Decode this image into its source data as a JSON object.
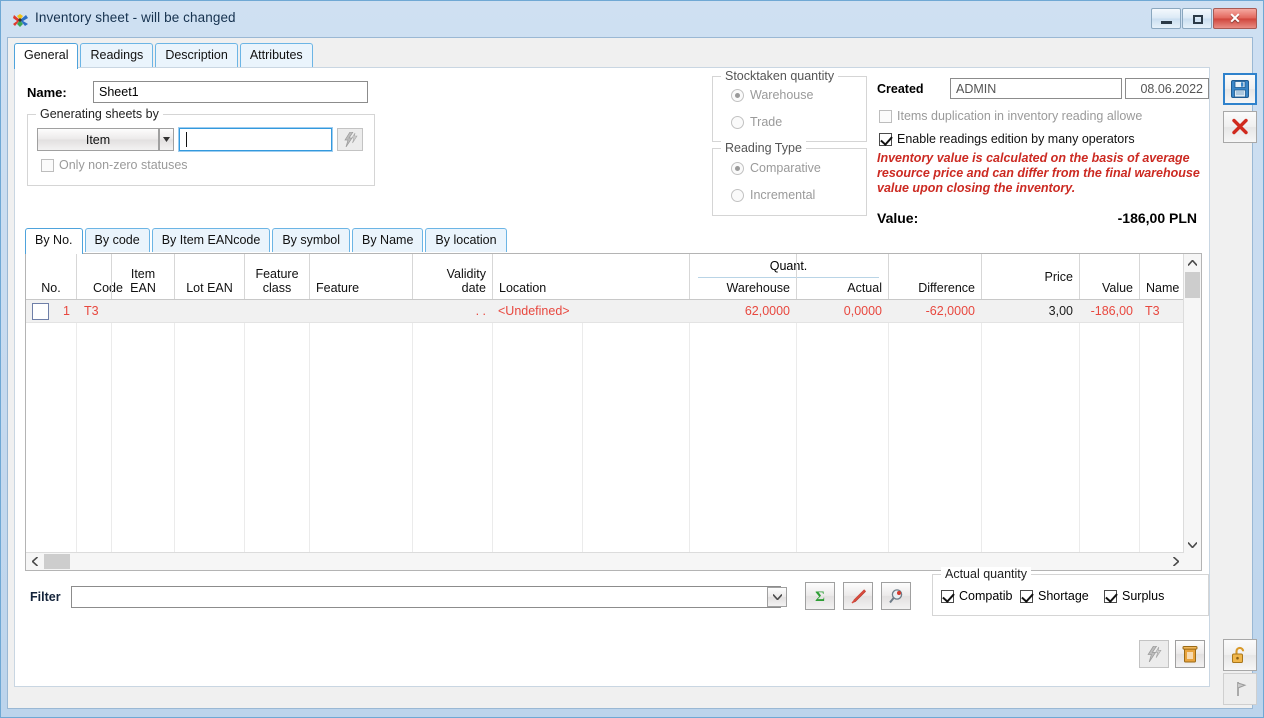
{
  "window": {
    "title": "Inventory sheet - will be changed",
    "icon": "butterfly-icon",
    "minimize_label": "Minimize",
    "maximize_label": "Maximize",
    "close_label": "✕"
  },
  "main_tabs": [
    {
      "label": "General",
      "active": true
    },
    {
      "label": "Readings",
      "active": false
    },
    {
      "label": "Description",
      "active": false
    },
    {
      "label": "Attributes",
      "active": false
    }
  ],
  "form": {
    "name_label": "Name:",
    "name_value": "Sheet1",
    "generating_group": "Generating sheets by",
    "generating_kind": "Item",
    "generating_value": "",
    "generating_placeholder": "",
    "generate_button_icon": "lightning-icon",
    "only_nonzero_label": "Only non-zero statuses",
    "only_nonzero_checked": false
  },
  "stocktaken": {
    "caption": "Stocktaken quantity",
    "options": [
      {
        "label": "Warehouse",
        "selected": true
      },
      {
        "label": "Trade",
        "selected": false
      }
    ]
  },
  "reading_type": {
    "caption": "Reading Type",
    "options": [
      {
        "label": "Comparative",
        "selected": true
      },
      {
        "label": "Incremental",
        "selected": false
      }
    ]
  },
  "created": {
    "label": "Created",
    "user": "ADMIN",
    "date": "08.06.2022",
    "duplication_label": "Items duplication in inventory reading allowe",
    "duplication_checked": false,
    "many_operators_label": "Enable readings edition by many operators",
    "many_operators_checked": true,
    "warning": "Inventory value is calculated on the basis of average resource price and can differ from the final warehouse value upon closing the inventory.",
    "value_label": "Value:",
    "value_amount": "-186,00 PLN"
  },
  "sub_tabs": [
    {
      "label": "By No.",
      "active": true
    },
    {
      "label": "By code",
      "active": false
    },
    {
      "label": "By Item EANcode",
      "active": false
    },
    {
      "label": "By symbol",
      "active": false
    },
    {
      "label": "By Name",
      "active": false
    },
    {
      "label": "By location",
      "active": false
    }
  ],
  "grid": {
    "group_header": "Quant.",
    "columns": [
      "No.",
      "Code",
      "Item EAN",
      "Lot EAN",
      "Feature class",
      "Feature",
      "Validity date",
      "Location",
      "Warehouse",
      "Actual",
      "Difference",
      "Price",
      "Value",
      "Name"
    ],
    "rows": [
      {
        "no": "1",
        "code": "T3",
        "item_ean": "",
        "lot_ean": "",
        "feature_class": "",
        "feature": "",
        "validity_date": ". .",
        "location": "<Undefined>",
        "warehouse": "62,0000",
        "actual": "0,0000",
        "difference": "-62,0000",
        "price": "3,00",
        "value": "-186,00",
        "name": "T3",
        "selected": false
      }
    ]
  },
  "filter": {
    "label": "Filter",
    "value": "",
    "placeholder": "",
    "dropdown_icon": "chevron-down-icon",
    "buttons": [
      {
        "name": "sum-button",
        "icon": "sigma-icon"
      },
      {
        "name": "edit-button",
        "icon": "pen-icon"
      },
      {
        "name": "find-button",
        "icon": "magnifier-icon"
      }
    ]
  },
  "actual_quantity": {
    "caption": "Actual quantity",
    "items": [
      {
        "label": "Compatib",
        "checked": true
      },
      {
        "label": "Shortage",
        "checked": true
      },
      {
        "label": "Surplus",
        "checked": true
      }
    ]
  },
  "bottom_buttons": [
    {
      "name": "generate-rows-button",
      "icon": "lightning-icon",
      "disabled": true
    },
    {
      "name": "delete-button",
      "icon": "trash-icon",
      "disabled": false
    }
  ],
  "rail_buttons": [
    {
      "name": "save-button",
      "icon": "floppy-icon",
      "focused": true
    },
    {
      "name": "cancel-button",
      "icon": "red-x-icon",
      "focused": false
    },
    {
      "name": "unlock-button",
      "icon": "open-padlock-icon",
      "focused": false
    },
    {
      "name": "pin-button",
      "icon": "pin-icon",
      "focused": false
    }
  ],
  "colors": {
    "accent": "#2f82cc",
    "row_text": "#e8483f",
    "warning": "#cc2a22",
    "title_text": "#16324f"
  }
}
